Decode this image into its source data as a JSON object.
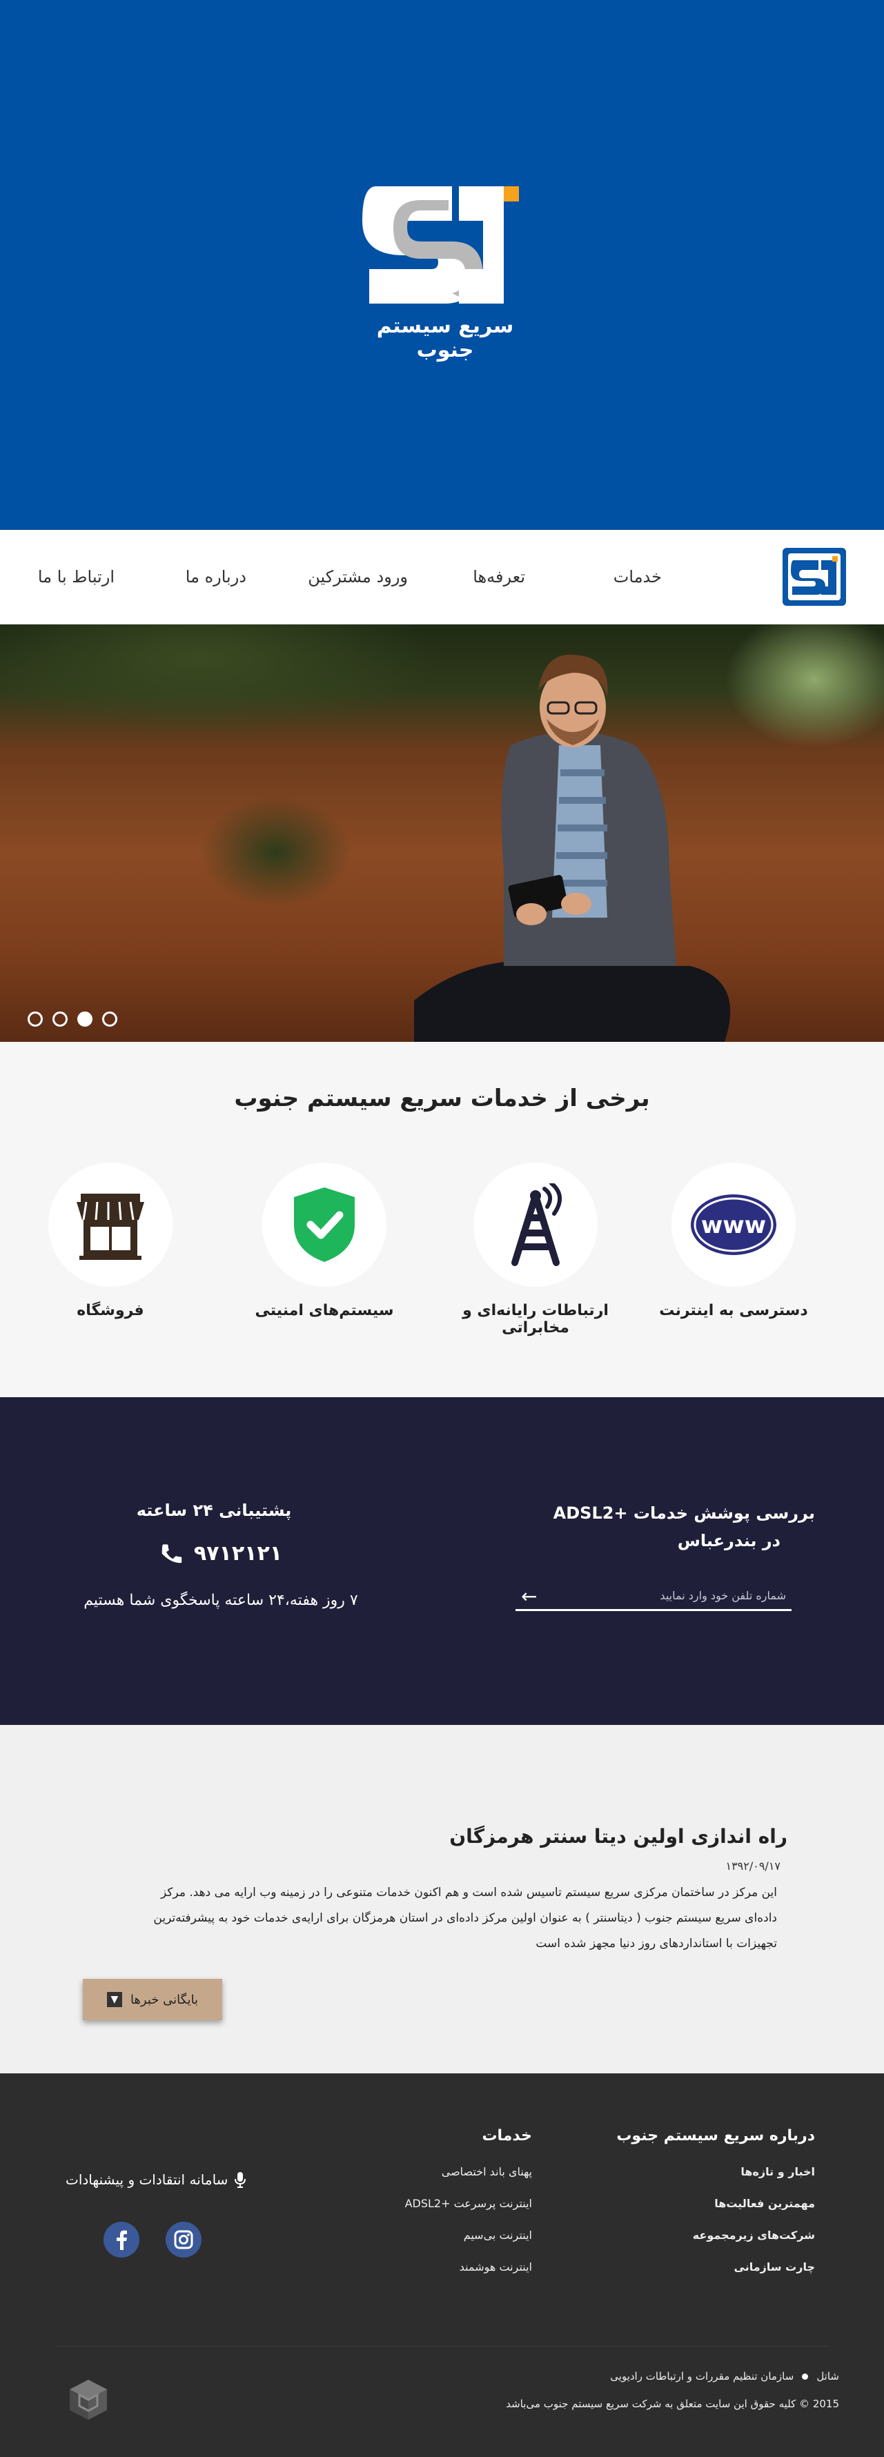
{
  "hero": {
    "logo_text": "سریع سیستم جنوب"
  },
  "nav": {
    "items": [
      {
        "label": "خدمات"
      },
      {
        "label": "تعرفه‌ها"
      },
      {
        "label": "ورود مشترکین"
      },
      {
        "label": "درباره ما"
      },
      {
        "label": "ارتباط با ما"
      }
    ]
  },
  "slider": {
    "dots": 4,
    "active_dot": 3
  },
  "services": {
    "title": "برخی از خدمات سریع سیستم جنوب",
    "items": [
      {
        "label": "دسترسی به اینترنت",
        "icon": "www-icon"
      },
      {
        "label": "ارتباطات رایانه‌ای و مخابراتی",
        "icon": "antenna-icon"
      },
      {
        "label": "سیستم‌های امنیتی",
        "icon": "shield-check-icon"
      },
      {
        "label": "فروشگاه",
        "icon": "shop-icon"
      }
    ]
  },
  "coverage": {
    "title_line1": "بررسی پوشش خدمات  +ADSL2",
    "title_line2": "در بندرعباس",
    "placeholder": "شماره تلفن خود وارد نمایید"
  },
  "support": {
    "title": "پشتیبانی ۲۴ ساعته",
    "phone": "۹۷۱۲۱۲۱",
    "hours": "۷ روز هفته،۲۴ ساعته پاسخگوی شما هستیم"
  },
  "news": {
    "title": "راه اندازی اولین دیتا سنتر هرمزگان",
    "date": "۱۳۹۲/۰۹/۱۷",
    "body": "این مرکز در ساختمان مرکزی سریع سیستم تاسیس شده است و هم اکنون خدمات متنوعی را در زمینه وب ارایه می دهد. مرکز داده‌ای سریع سیستم جنوب ( دیتاسنتر ) به عنوان اولین مرکز داده‌ای در استان هرمزگان برای ارایه‌ی خدمات خود به پیشرفته‌ترین تجهیزات با استانداردهای روز دنیا مجهز شده است",
    "archive_label": "بایگانی خبرها"
  },
  "footer": {
    "about": {
      "title": "درباره سریع سیستم جنوب",
      "links": [
        "اخبار و تازه‌ها",
        "مهمترین فعالیت‌ها",
        "شرکت‌های زیرمجموعه",
        "چارت سازمانی"
      ]
    },
    "services": {
      "title": "خدمات",
      "links": [
        "پهنای باند اختصاصی",
        "اینترنت پرسرعت +ADSL2",
        "اینترنت بی‌سیم",
        "اینترنت هوشمند"
      ]
    },
    "feedback": "سامانه انتقادات و پیشنهادات",
    "shatel": "شاتل",
    "regulator": "سازمان تنظیم مقررات و ارتباطات رادیویی",
    "copyright": "2015 © کلیه حقوق این سایت متعلق به شرکت سریع سیستم جنوب می‌باشد"
  },
  "colors": {
    "brand_blue": "#0050a4",
    "dark_band": "#1f1f3a",
    "footer_bg": "#2d2d2d",
    "archive_button": "#c5a88b",
    "accent_orange": "#f7a21b",
    "shield_green": "#1fb55b"
  }
}
